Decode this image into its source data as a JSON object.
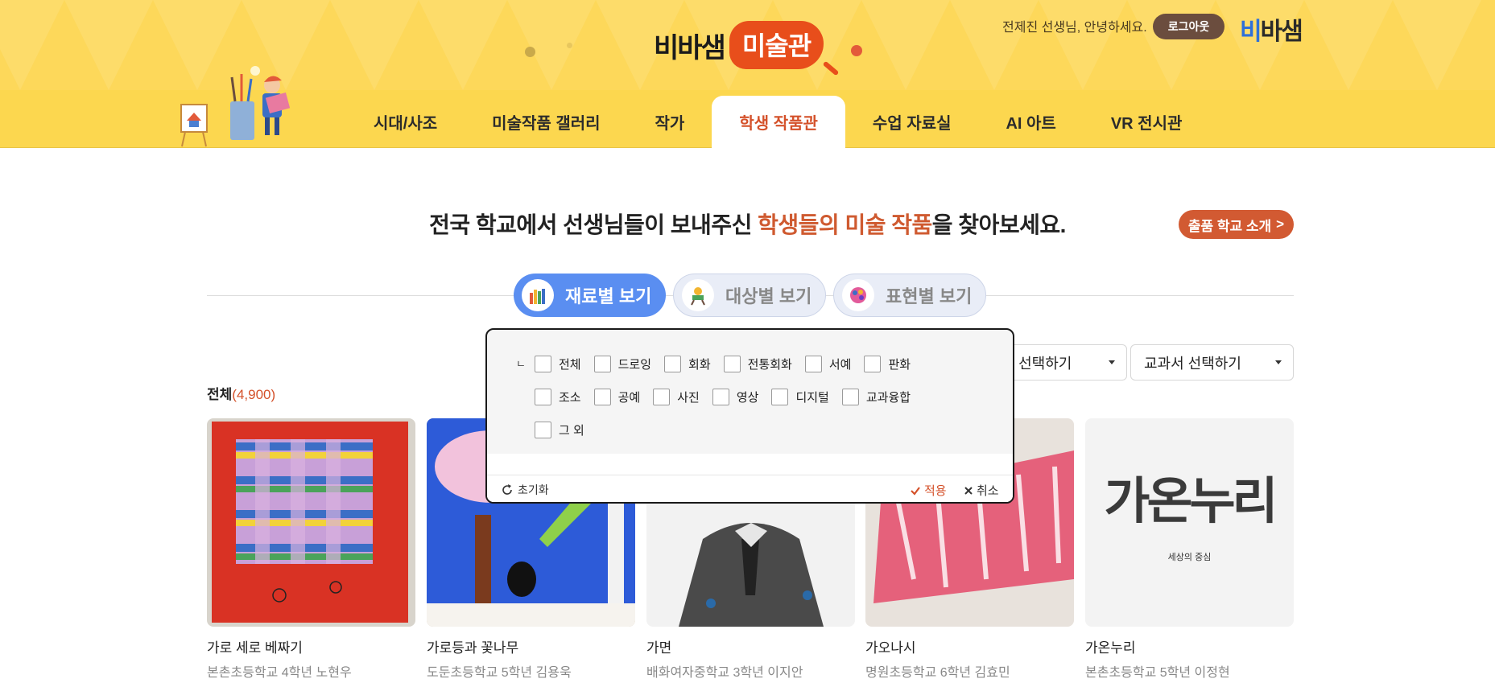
{
  "header": {
    "logo_word": "비바샘",
    "logo_badge": "미술관",
    "greeting": "전제진 선생님, 안녕하세요.",
    "logout_label": "로그아웃",
    "brand_first": "비",
    "brand_rest": "바샘"
  },
  "nav": {
    "items": [
      {
        "label": "시대/사조"
      },
      {
        "label": "미술작품 갤러리"
      },
      {
        "label": "작가"
      },
      {
        "label": "학생 작품관"
      },
      {
        "label": "수업 자료실"
      },
      {
        "label": "AI 아트"
      },
      {
        "label": "VR 전시관"
      }
    ],
    "active": "학생 작품관"
  },
  "hero": {
    "text_before": "전국 학교에서 선생님들이 보내주신 ",
    "text_highlight": "학생들의 미술 작품",
    "text_after": "을 찾아보세요.",
    "school_button": "출품 학교 소개",
    "school_button_arrow": ">"
  },
  "view_tabs": [
    {
      "label": "재료별 보기",
      "icon": "paint-supplies-icon",
      "active": true
    },
    {
      "label": "대상별 보기",
      "icon": "easel-icon",
      "active": false
    },
    {
      "label": "표현별 보기",
      "icon": "palette-icon",
      "active": false
    }
  ],
  "filters": {
    "grade": "학년 선택하기",
    "textbook": "교과서 선택하기"
  },
  "count": {
    "label": "전체",
    "value": "(4,900)"
  },
  "popup": {
    "corner_mark": "ㄴ",
    "row1": [
      "전체",
      "드로잉",
      "회화",
      "전통회화",
      "서예",
      "판화"
    ],
    "row2": [
      "조소",
      "공예",
      "사진",
      "영상",
      "디지털",
      "교과융합"
    ],
    "row3": [
      "그 외"
    ],
    "reset_label": "초기화",
    "apply_label": "적용",
    "cancel_label": "취소"
  },
  "cards": [
    {
      "title": "가로 세로 베짜기",
      "sub": "본촌초등학교 4학년 노현우"
    },
    {
      "title": "가로등과 꽃나무",
      "sub": "도둔초등학교 5학년 김용욱"
    },
    {
      "title": "가면",
      "sub": "배화여자중학교 3학년 이지안"
    },
    {
      "title": "가오나시",
      "sub": "명원초등학교 6학년 김효민"
    },
    {
      "title": "가온누리",
      "sub": "본촌초등학교 5학년 이정현"
    }
  ],
  "card5_art": {
    "big": "가온누리",
    "small": "세상의 중심"
  },
  "colors": {
    "header_yellow": "#fdd85a",
    "accent_orange": "#d4512a",
    "tab_blue": "#5a8ef1",
    "logout_brown": "#6b4d3e"
  }
}
